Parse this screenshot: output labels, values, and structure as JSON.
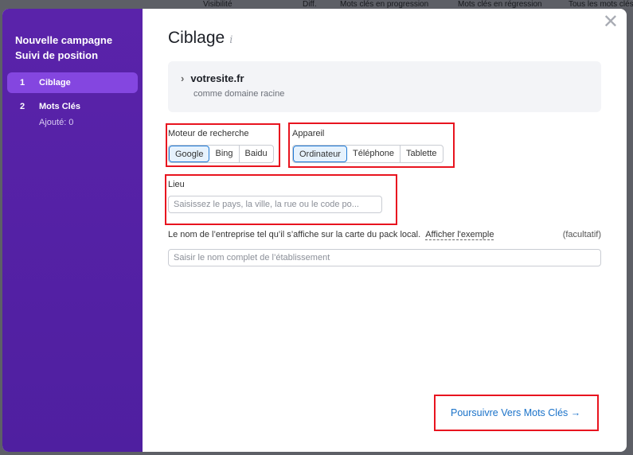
{
  "background_headers": [
    "Visibilité",
    "Diff.",
    "Mots clés en progression",
    "Mots clés en régression",
    "Tous les mots clés"
  ],
  "sidebar": {
    "title_line1": "Nouvelle campagne",
    "title_line2": "Suivi de position",
    "steps": [
      {
        "num": "1",
        "label": "Ciblage",
        "active": true
      },
      {
        "num": "2",
        "label": "Mots Clés",
        "sub": "Ajouté: 0"
      }
    ]
  },
  "main": {
    "title": "Ciblage",
    "info_icon": "i",
    "domain": {
      "name": "votresite.fr",
      "desc": "comme domaine racine"
    },
    "engine": {
      "label": "Moteur de recherche",
      "options": [
        "Google",
        "Bing",
        "Baidu"
      ],
      "selected": "Google"
    },
    "device": {
      "label": "Appareil",
      "options": [
        "Ordinateur",
        "Téléphone",
        "Tablette"
      ],
      "selected": "Ordinateur"
    },
    "location": {
      "label": "Lieu",
      "placeholder": "Saisissez le pays, la ville, la rue ou le code po..."
    },
    "business": {
      "label": "Le nom de l’entreprise tel qu’il s’affiche sur la carte du pack local.",
      "link": "Afficher l'exemple",
      "optional": "(facultatif)",
      "placeholder": "Saisir le nom complet de l’établissement"
    },
    "next_button": "Poursuivre Vers Mots Clés →"
  },
  "colors": {
    "sidebar": "#5a23aa",
    "active_step": "#8446e0",
    "accent": "#1a72c9",
    "highlight": "#e8141f"
  }
}
